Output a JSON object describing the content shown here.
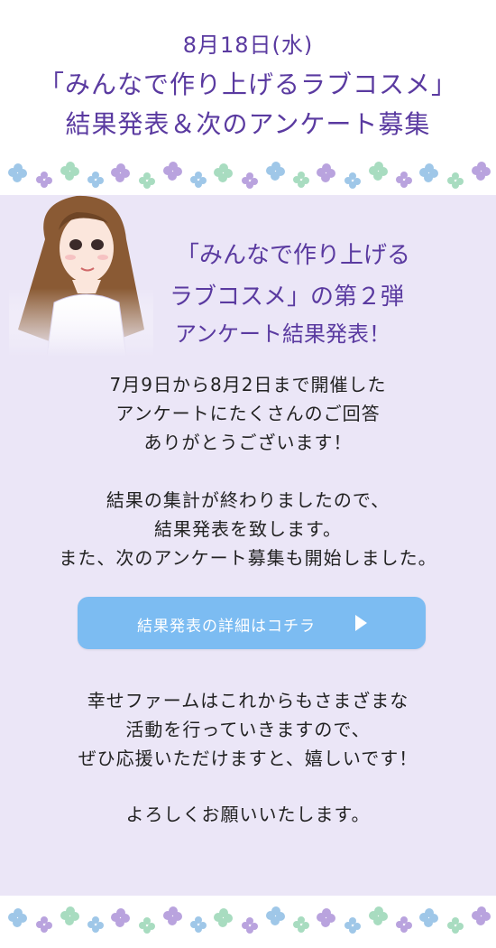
{
  "header": {
    "date": "8月18日(水)",
    "title_line1": "「みんなで作り上げるラブコスメ」",
    "title_line2": "結果発表＆次のアンケート募集"
  },
  "intro": {
    "line1": "「みんなで作り上げる",
    "line2": "ラブコスメ」の第２弾",
    "line3": "アンケート結果発表！"
  },
  "message": {
    "p1": [
      "7月9日から8月2日まで開催した",
      "アンケートにたくさんのご回答",
      "ありがとうございます！"
    ],
    "p2": [
      "結果の集計が終わりましたので、",
      "結果発表を致します。",
      "また、次のアンケート募集も開始しました。"
    ],
    "p3": [
      "幸せファームはこれからもさまざまな",
      "活動を行っていきますので、",
      "ぜひ応援いただけますと、嬉しいです！"
    ],
    "closing": "よろしくお願いいたします。"
  },
  "cta": {
    "label": "結果発表の詳細はコチラ",
    "arrow_icon": "play-triangle-icon"
  },
  "colors": {
    "accent": "#5a3aa0",
    "panel_bg": "#ebe6f7",
    "button_bg": "#7cbcf2",
    "text": "#222222"
  }
}
